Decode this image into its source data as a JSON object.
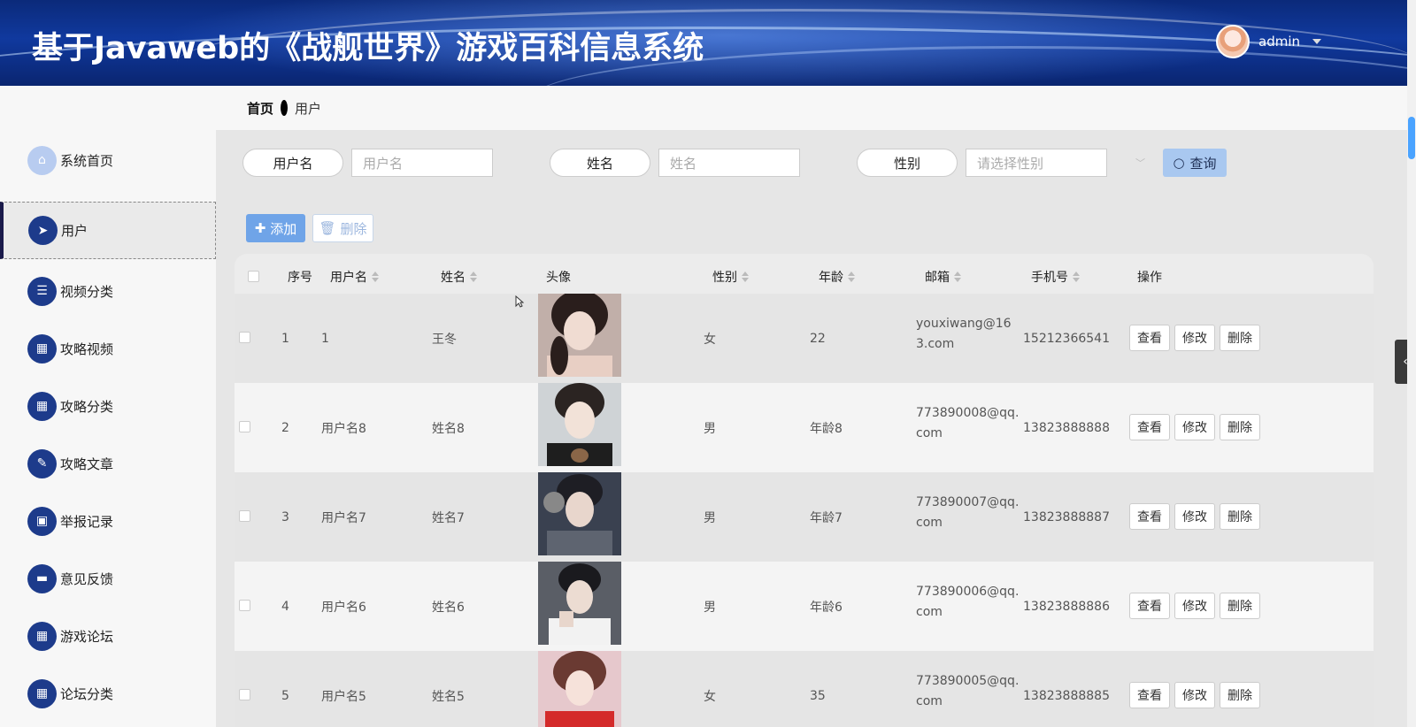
{
  "header": {
    "title": "基于Javaweb的《战舰世界》游戏百科信息系统",
    "username": "admin"
  },
  "sidebar": {
    "items": [
      {
        "label": "系统首页",
        "icon": "home-icon"
      },
      {
        "label": "用户",
        "icon": "paper-plane-icon"
      },
      {
        "label": "视频分类",
        "icon": "list-icon"
      },
      {
        "label": "攻略视频",
        "icon": "grid-icon"
      },
      {
        "label": "攻略分类",
        "icon": "grid-icon"
      },
      {
        "label": "攻略文章",
        "icon": "clipboard-icon"
      },
      {
        "label": "举报记录",
        "icon": "briefcase-icon"
      },
      {
        "label": "意见反馈",
        "icon": "ticket-icon"
      },
      {
        "label": "游戏论坛",
        "icon": "grid-icon"
      },
      {
        "label": "论坛分类",
        "icon": "grid-icon"
      }
    ],
    "active": "用户"
  },
  "breadcrumb": {
    "home": "首页",
    "current": "用户"
  },
  "search": {
    "username_label": "用户名",
    "username_placeholder": "用户名",
    "name_label": "姓名",
    "name_placeholder": "姓名",
    "gender_label": "性别",
    "gender_placeholder": "请选择性别",
    "query_label": "查询"
  },
  "actions": {
    "add_label": "添加",
    "delete_label": "删除"
  },
  "table": {
    "columns": [
      "序号",
      "用户名",
      "姓名",
      "头像",
      "性别",
      "年龄",
      "邮箱",
      "手机号",
      "操作"
    ],
    "row_actions": {
      "view": "查看",
      "edit": "修改",
      "delete": "删除"
    },
    "rows": [
      {
        "index": "1",
        "username": "1",
        "name": "王冬",
        "gender": "女",
        "age": "22",
        "email": "youxiwang@163.com",
        "phone": "15212366541"
      },
      {
        "index": "2",
        "username": "用户名8",
        "name": "姓名8",
        "gender": "男",
        "age": "年龄8",
        "email": "773890008@qq.com",
        "phone": "13823888888"
      },
      {
        "index": "3",
        "username": "用户名7",
        "name": "姓名7",
        "gender": "男",
        "age": "年龄7",
        "email": "773890007@qq.com",
        "phone": "13823888887"
      },
      {
        "index": "4",
        "username": "用户名6",
        "name": "姓名6",
        "gender": "男",
        "age": "年龄6",
        "email": "773890006@qq.com",
        "phone": "13823888886"
      },
      {
        "index": "5",
        "username": "用户名5",
        "name": "姓名5",
        "gender": "女",
        "age": "35",
        "email": "773890005@qq.com",
        "phone": "13823888885"
      }
    ]
  },
  "colors": {
    "header_bg": "#10399e",
    "sidebar_icon": "#1d3b8b",
    "add_button": "#6fa4e8",
    "query_button": "#a9c8f0"
  }
}
